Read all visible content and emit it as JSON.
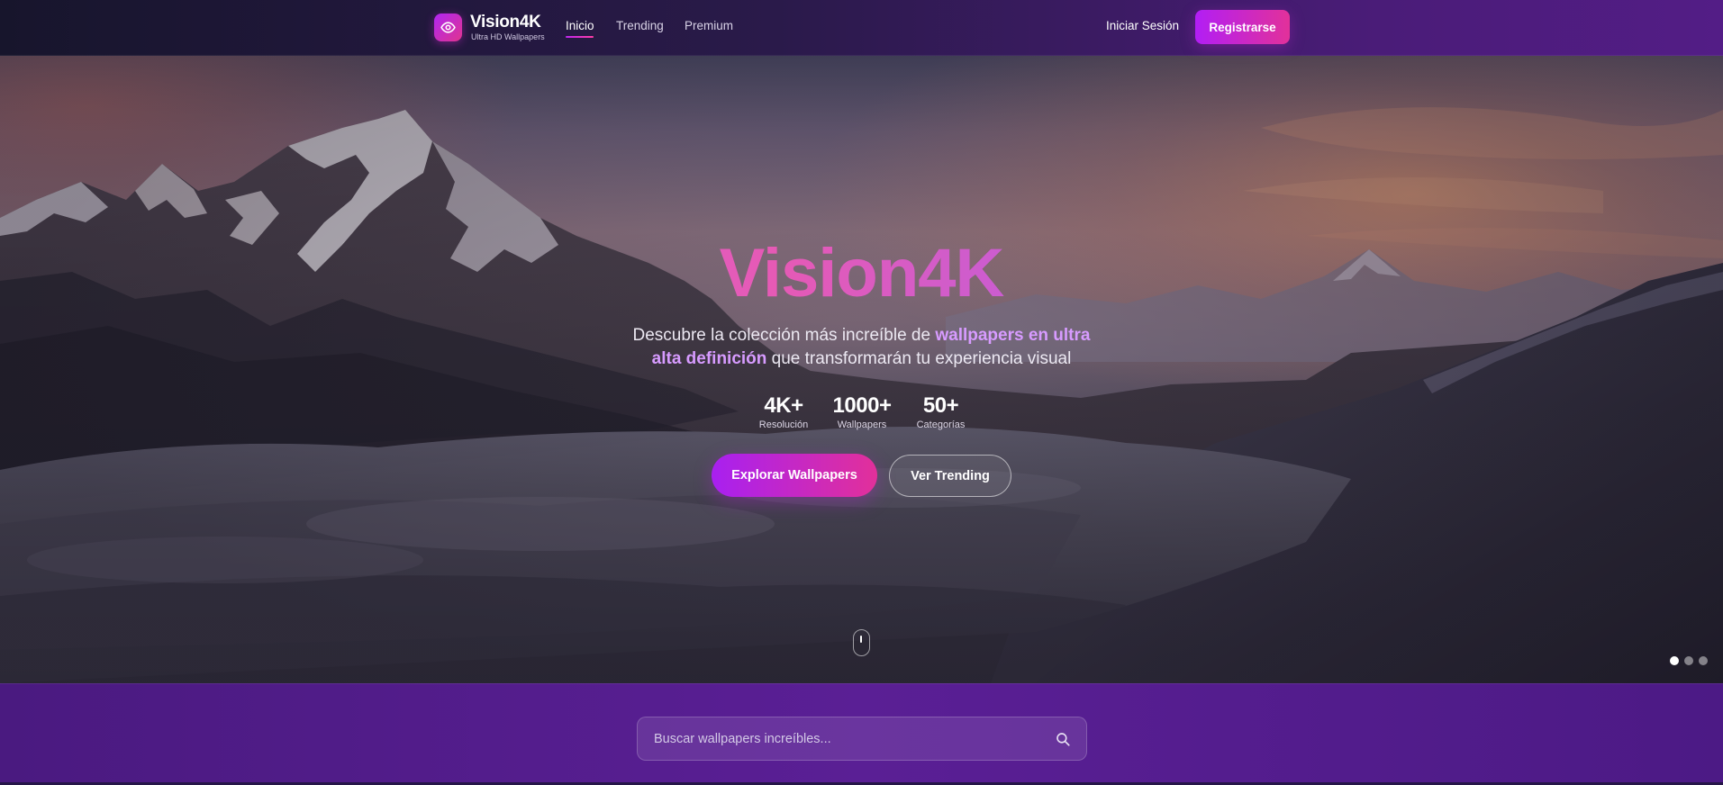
{
  "brand": {
    "name": "Vision4K",
    "tagline": "Ultra HD Wallpapers",
    "logo_icon": "eye-icon"
  },
  "nav": {
    "links": [
      {
        "label": "Inicio",
        "active": true
      },
      {
        "label": "Trending",
        "active": false
      },
      {
        "label": "Premium",
        "active": false
      }
    ],
    "login_label": "Iniciar Sesión",
    "register_label": "Registrarse"
  },
  "hero": {
    "title": "Vision4K",
    "description_pre": "Descubre la colección más increíble de ",
    "description_highlight": "wallpapers en ultra alta definición",
    "description_post": " que transformarán tu experiencia visual",
    "stats": [
      {
        "value": "4K+",
        "label": "Resolución"
      },
      {
        "value": "1000+",
        "label": "Wallpapers"
      },
      {
        "value": "50+",
        "label": "Categorías"
      }
    ],
    "explore_label": "Explorar Wallpapers",
    "trending_label": "Ver Trending",
    "slides": 3,
    "active_slide": 1
  },
  "search": {
    "placeholder": "Buscar wallpapers increíbles...",
    "value": "",
    "icon": "search-icon"
  },
  "colors": {
    "accent_purple": "#b21ef5",
    "accent_pink": "#e2319a",
    "highlight": "#d79bff"
  }
}
